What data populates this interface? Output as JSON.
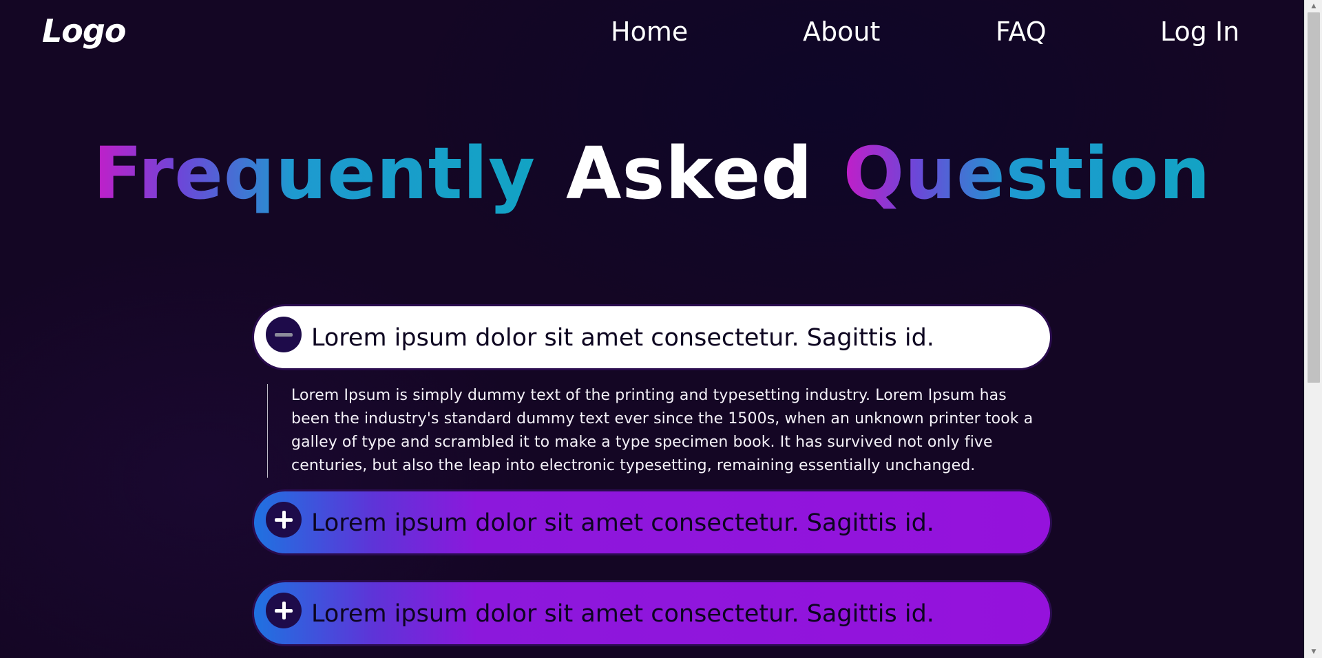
{
  "header": {
    "logo": "Logo",
    "nav": [
      {
        "label": "Home"
      },
      {
        "label": "About"
      },
      {
        "label": "FAQ"
      },
      {
        "label": "Log In"
      }
    ]
  },
  "title": {
    "word1": "Frequently",
    "word2": "Asked",
    "word3": "Question"
  },
  "faq": [
    {
      "question": "Lorem ipsum dolor sit amet consectetur. Sagittis id.",
      "state": "open",
      "icon": "minus-icon",
      "answer": "Lorem Ipsum is simply dummy text of the printing and typesetting industry. Lorem Ipsum has been the industry's standard dummy text ever since the 1500s, when an unknown printer took a galley of type and scrambled it to make a type specimen book. It has survived not only five centuries, but also the leap into electronic typesetting, remaining essentially unchanged."
    },
    {
      "question": "Lorem ipsum dolor sit amet consectetur. Sagittis id.",
      "state": "closed",
      "icon": "plus-icon"
    },
    {
      "question": "Lorem ipsum dolor sit amet consectetur. Sagittis id.",
      "state": "closed",
      "icon": "plus-icon"
    }
  ],
  "colors": {
    "background": "#140624",
    "title_gradient_start": "#c21ec8",
    "title_gradient_end": "#12a3c4",
    "item_gradient_start": "#1f72e0",
    "item_gradient_end": "#9512dc",
    "icon_circle": "#1e0b4a"
  }
}
